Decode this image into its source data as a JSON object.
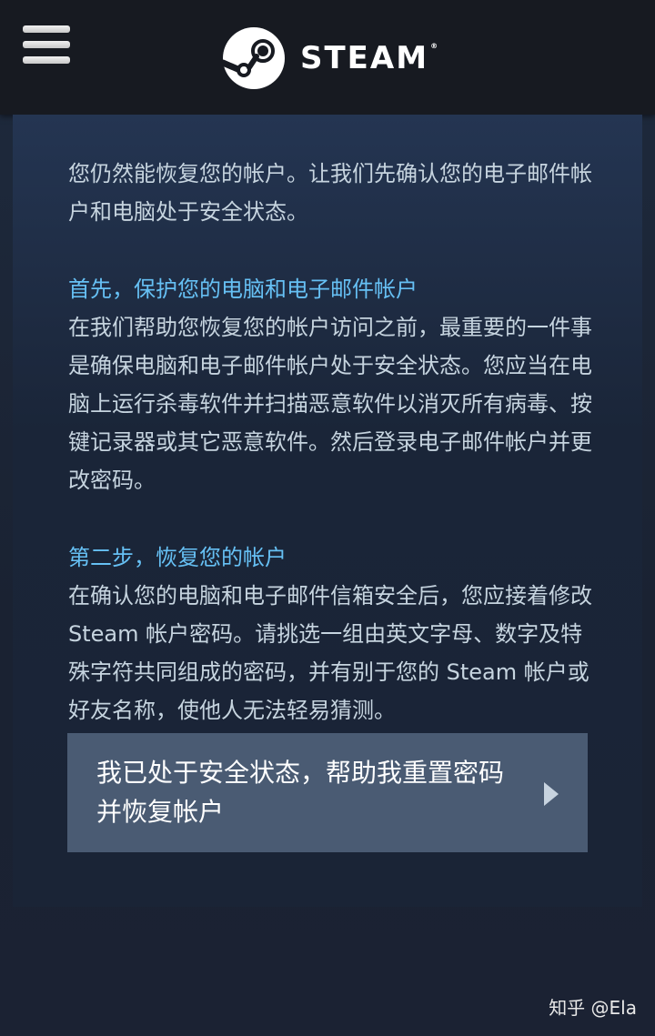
{
  "header": {
    "brand": "STEAM",
    "brand_mark": "®",
    "menu_icon": "hamburger-menu-icon",
    "logo_icon": "steam-logo-icon"
  },
  "content": {
    "intro": "您仍然能恢复您的帐户。让我们先确认您的电子邮件帐户和电脑处于安全状态。",
    "section1_title": "首先，保护您的电脑和电子邮件帐户",
    "section1_body": "在我们帮助您恢复您的帐户访问之前，最重要的一件事是确保电脑和电子邮件帐户处于安全状态。您应当在电脑上运行杀毒软件并扫描恶意软件以消灭所有病毒、按键记录器或其它恶意软件。然后登录电子邮件帐户并更改密码。",
    "section2_title": "第二步，恢复您的帐户",
    "section2_body": "在确认您的电脑和电子邮件信箱安全后，您应接着修改 Steam 帐户密码。请挑选一组由英文字母、数字及特殊字符共同组成的密码，并有别于您的 Steam 帐户或好友名称，使他人无法轻易猜测。"
  },
  "action": {
    "label": "我已处于安全状态，帮助我重置密码并恢复帐户",
    "arrow_icon": "chevron-right-icon"
  },
  "watermark": "知乎 @Ela",
  "colors": {
    "header_bg": "#171a21",
    "link_blue": "#66c0f4",
    "body_text": "#c6d4df",
    "button_bg": "#4a5b73"
  }
}
